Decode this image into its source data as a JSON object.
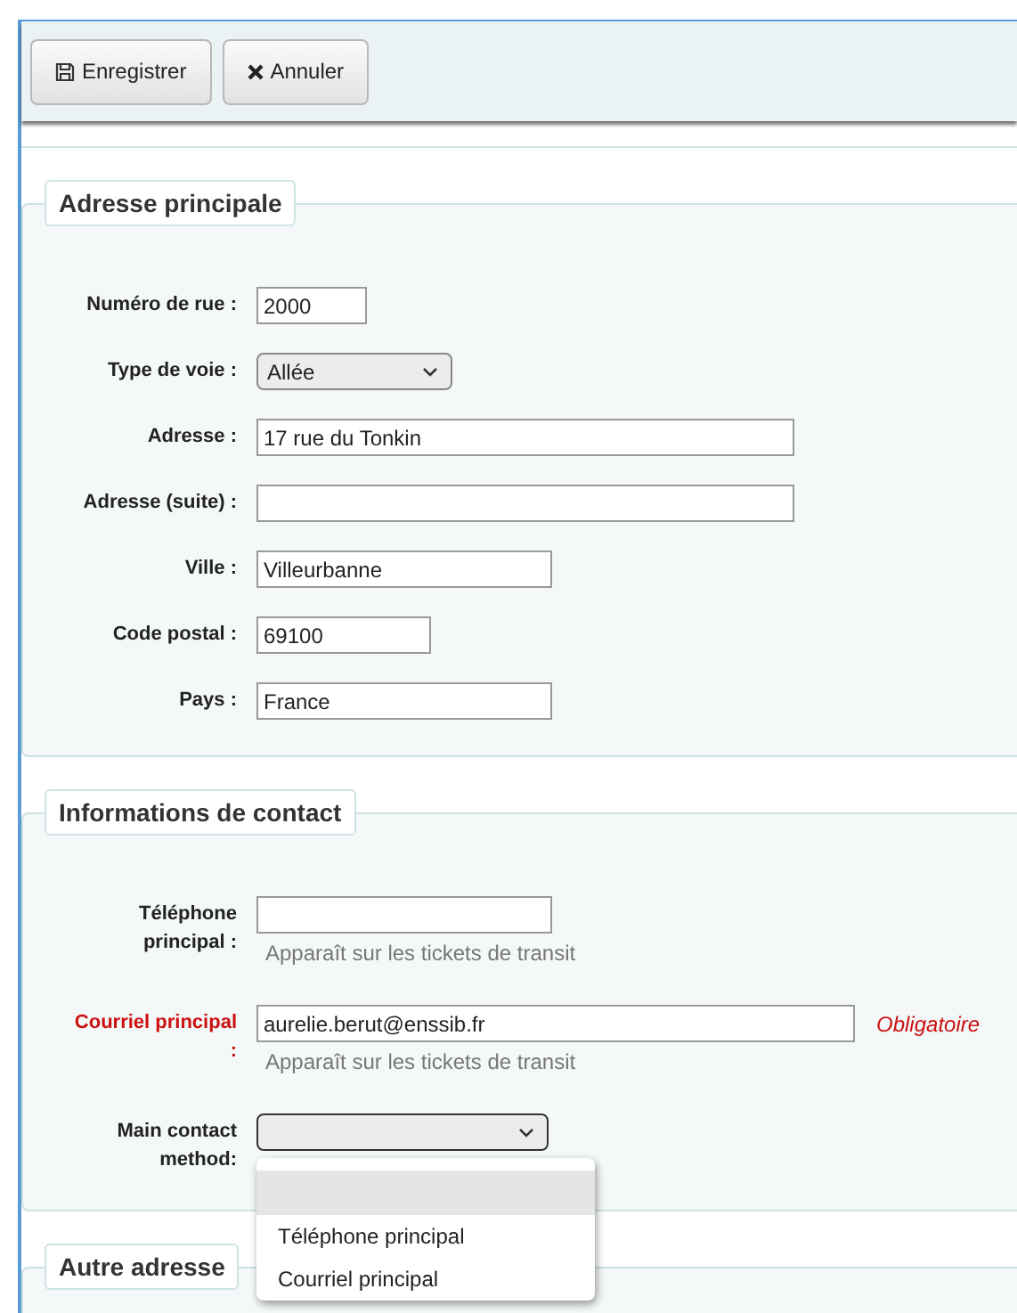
{
  "toolbar": {
    "buttons": [
      {
        "kind": "save",
        "label": "Enregistrer"
      },
      {
        "kind": "cancel",
        "label": "Annuler"
      }
    ]
  },
  "sections": [
    {
      "legend": "Adresse principale",
      "fields": [
        {
          "kind": "text",
          "label": "Numéro de rue :",
          "value": "2000",
          "required": false
        },
        {
          "kind": "select",
          "label": "Type de voie :",
          "value": "Allée",
          "required": false
        },
        {
          "kind": "text",
          "label": "Adresse :",
          "value": "17 rue du Tonkin",
          "required": false
        },
        {
          "kind": "text",
          "label": "Adresse (suite) :",
          "required": false
        },
        {
          "kind": "text",
          "label": "Ville :",
          "value": "Villeurbanne",
          "required": false
        },
        {
          "kind": "text",
          "label": "Code postal :",
          "value": "69100",
          "required": false
        },
        {
          "kind": "text",
          "label": "Pays :",
          "value": "France",
          "required": false
        }
      ]
    },
    {
      "legend": "Informations de contact",
      "fields": [
        {
          "kind": "text",
          "label": "Téléphone principal :",
          "hint": "Apparaît sur les tickets de transit",
          "required": false
        },
        {
          "kind": "text",
          "label": "Courriel principal :",
          "value": "aurelie.berut@enssib.fr",
          "hint": "Apparaît sur les tickets de transit",
          "required": true,
          "required_note": "Obligatoire"
        },
        {
          "kind": "select",
          "label": "Main contact method:",
          "required": false,
          "expanded": true,
          "menu": {
            "blank_option_selected": true,
            "options": [
              {
                "label": "Téléphone principal",
                "selected": false
              },
              {
                "label": "Courriel principal",
                "selected": false
              }
            ]
          }
        }
      ]
    },
    {
      "legend": "Autre adresse"
    }
  ]
}
